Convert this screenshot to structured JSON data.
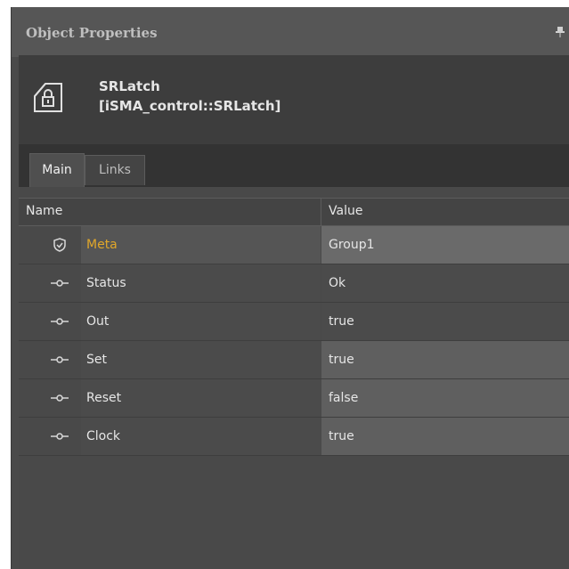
{
  "panel": {
    "title": "Object Properties",
    "pin_icon": "pin-icon"
  },
  "object": {
    "icon": "srlatch-object-icon",
    "name": "SRLatch",
    "type": "[iSMA_control::SRLatch]"
  },
  "tabs": [
    {
      "label": "Main",
      "active": true
    },
    {
      "label": "Links",
      "active": false
    }
  ],
  "grid": {
    "columns": {
      "name": "Name",
      "value": "Value"
    },
    "rows": [
      {
        "icon": "shield-icon",
        "name": "Meta",
        "value": "Group1"
      },
      {
        "icon": "slot-connector-icon",
        "name": "Status",
        "value": "Ok"
      },
      {
        "icon": "slot-connector-icon",
        "name": "Out",
        "value": "true"
      },
      {
        "icon": "slot-connector-icon",
        "name": "Set",
        "value": "true"
      },
      {
        "icon": "slot-connector-icon",
        "name": "Reset",
        "value": "false"
      },
      {
        "icon": "slot-connector-icon",
        "name": "Clock",
        "value": "true"
      }
    ]
  },
  "colors": {
    "panel_bg": "#4a4a4a",
    "header_bg": "#3d3d3d",
    "meta_label": "#e0a72a",
    "text": "#e6e6e6"
  }
}
